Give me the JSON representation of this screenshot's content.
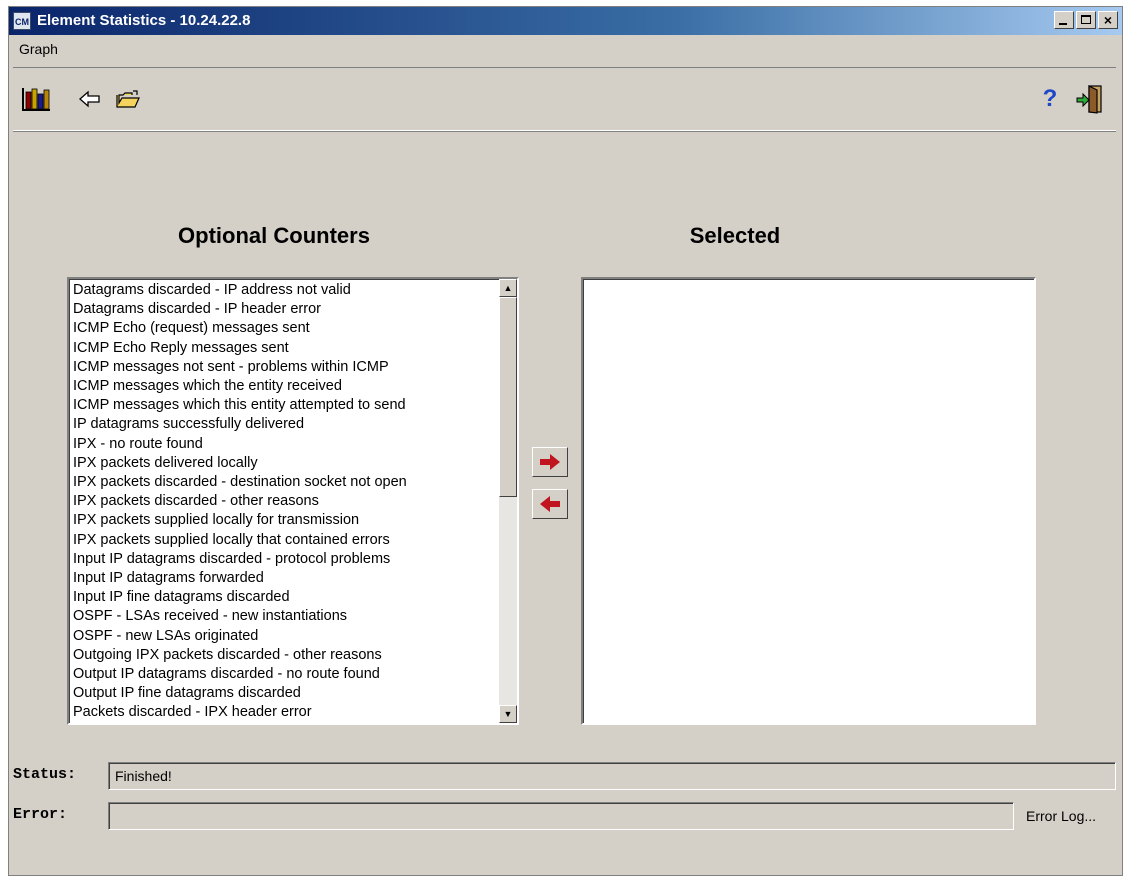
{
  "window": {
    "title": "Element Statistics - 10.24.22.8",
    "app_icon_text": "CM"
  },
  "menu": {
    "items": [
      "Graph"
    ]
  },
  "toolbar": {
    "left_icons": [
      "bar-chart-icon",
      "back-arrow-icon",
      "open-folder-icon"
    ],
    "right_icons": [
      "help-icon",
      "exit-icon"
    ],
    "help_glyph": "?"
  },
  "optional_counters": {
    "heading": "Optional Counters",
    "items": [
      "Datagrams discarded - IP address not valid",
      "Datagrams discarded - IP header error",
      "ICMP Echo (request) messages sent",
      "ICMP Echo Reply messages sent",
      "ICMP messages not sent - problems within ICMP",
      "ICMP messages which the entity received",
      "ICMP messages which this entity attempted to send",
      "IP datagrams successfully delivered",
      "IPX - no route found",
      "IPX packets delivered locally",
      "IPX packets discarded - destination socket not open",
      "IPX packets discarded - other reasons",
      "IPX packets supplied locally for transmission",
      "IPX packets supplied locally that contained errors",
      "Input IP datagrams discarded - protocol problems",
      "Input IP datagrams forwarded",
      "Input IP fine datagrams discarded",
      "OSPF - LSAs received - new instantiations",
      "OSPF - new LSAs originated",
      "Outgoing IPX packets discarded - other reasons",
      "Output IP datagrams discarded - no route found",
      "Output IP fine datagrams discarded",
      "Packets discarded - IPX header error"
    ],
    "scroll_position": 0
  },
  "selected": {
    "heading": "Selected",
    "items": []
  },
  "controls": {
    "add_icon": "right-arrow-icon",
    "remove_icon": "left-arrow-icon"
  },
  "status": {
    "label": "Status:",
    "value": "Finished!"
  },
  "error": {
    "label": "Error:",
    "value": "",
    "log_link": "Error Log..."
  },
  "colors": {
    "titlebar_start": "#0a246a",
    "titlebar_end": "#a6caf0",
    "face": "#d4d0c8",
    "arrow_red": "#c0141e"
  }
}
